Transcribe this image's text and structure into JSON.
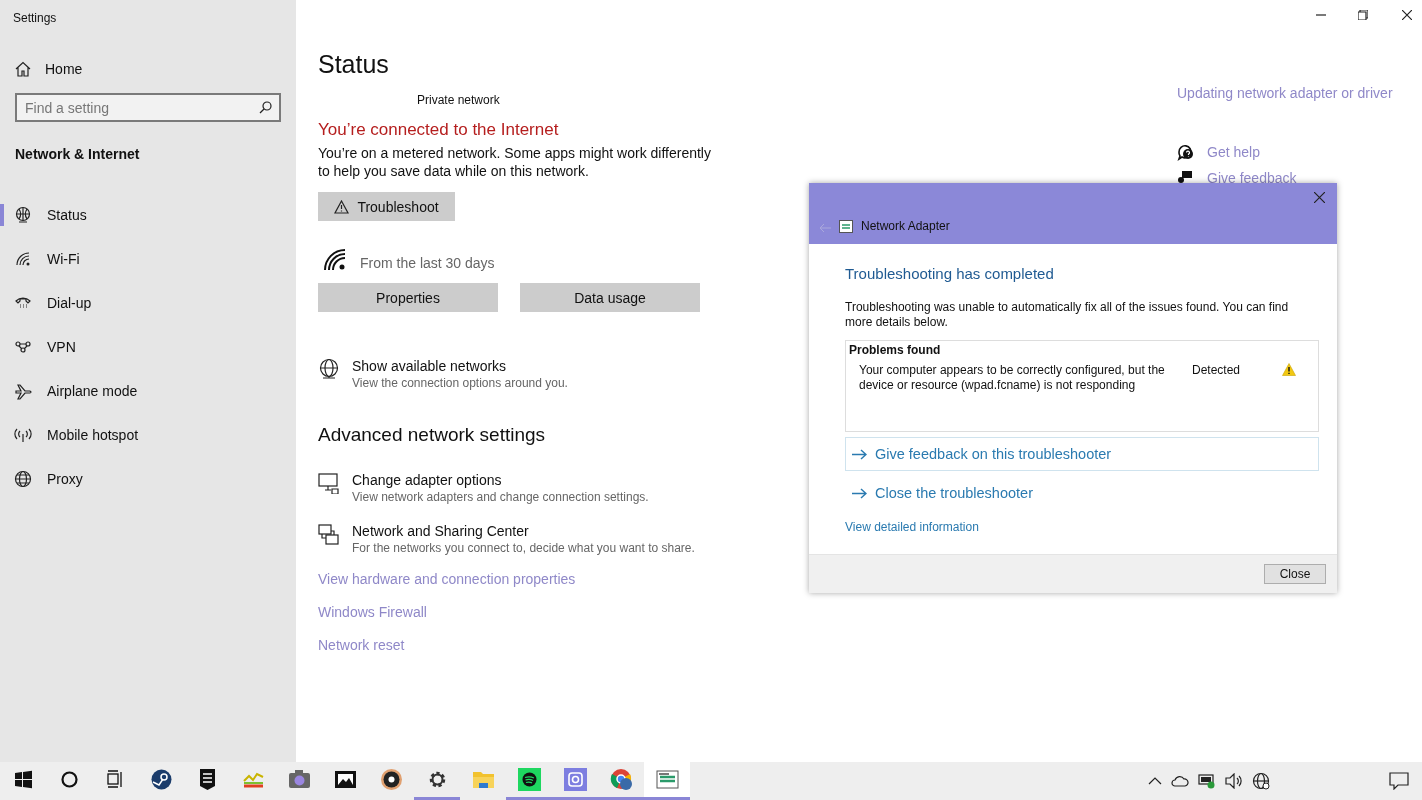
{
  "window": {
    "title": "Settings"
  },
  "sidebar": {
    "home": "Home",
    "search": {
      "placeholder": "Find a setting"
    },
    "section": "Network & Internet",
    "items": [
      {
        "label": "Status",
        "kind": "status",
        "selected": true
      },
      {
        "label": "Wi-Fi",
        "kind": "wifi",
        "selected": false
      },
      {
        "label": "Dial-up",
        "kind": "dialup",
        "selected": false
      },
      {
        "label": "VPN",
        "kind": "vpn",
        "selected": false
      },
      {
        "label": "Airplane mode",
        "kind": "airplane",
        "selected": false
      },
      {
        "label": "Mobile hotspot",
        "kind": "hotspot",
        "selected": false
      },
      {
        "label": "Proxy",
        "kind": "proxy",
        "selected": false
      }
    ]
  },
  "main": {
    "title": "Status",
    "network_name": "Private network",
    "connection_heading": "You’re connected to the Internet",
    "connection_text": "You’re on a metered network. Some apps might work differently to help you save data while on this network.",
    "troubleshoot_button": "Troubleshoot",
    "usage_caption": "From the last 30 days",
    "buttons": [
      "Properties",
      "Data usage"
    ],
    "show_networks": {
      "kind": "networks",
      "title": "Show available networks",
      "subtitle": "View the connection options around you."
    },
    "advanced_heading": "Advanced network settings",
    "advanced_items": [
      {
        "kind": "adapter",
        "title": "Change adapter options",
        "subtitle": "View network adapters and change connection settings."
      },
      {
        "kind": "sharing",
        "title": "Network and Sharing Center",
        "subtitle": "For the networks you connect to, decide what you want to share."
      }
    ],
    "links": [
      "View hardware and connection properties",
      "Windows Firewall",
      "Network reset"
    ]
  },
  "related": {
    "links": [
      "Updating network adapter or driver"
    ],
    "help": [
      {
        "kind": "help",
        "label": "Get help"
      },
      {
        "kind": "feedback",
        "label": "Give feedback"
      }
    ]
  },
  "dialog": {
    "title": "Network Adapter",
    "heading": "Troubleshooting has completed",
    "message": "Troubleshooting was unable to automatically fix all of the issues found. You can find more details below.",
    "problems": {
      "heading": "Problems found",
      "rows": [
        {
          "text": "Your computer appears to be correctly configured, but the device or resource (wpad.fcname) is not responding",
          "status": "Detected",
          "kind": "warning"
        }
      ]
    },
    "actions": [
      {
        "label": "Give feedback on this troubleshooter",
        "focused": true
      },
      {
        "label": "Close the troubleshooter",
        "focused": false
      }
    ],
    "details_link": "View detailed information",
    "close_button": "Close"
  },
  "taskbar": {
    "apps": [
      {
        "kind": "start",
        "running": false,
        "selected": false
      },
      {
        "kind": "search",
        "running": false,
        "selected": false
      },
      {
        "kind": "taskview",
        "running": false,
        "selected": false
      },
      {
        "kind": "steam",
        "running": false,
        "selected": false
      },
      {
        "kind": "epic",
        "running": false,
        "selected": false
      },
      {
        "kind": "chart",
        "running": false,
        "selected": false
      },
      {
        "kind": "camera",
        "running": false,
        "selected": false
      },
      {
        "kind": "photos",
        "running": false,
        "selected": false
      },
      {
        "kind": "music",
        "running": false,
        "selected": false
      },
      {
        "kind": "settings",
        "running": true,
        "selected": false
      },
      {
        "kind": "folder",
        "running": false,
        "selected": false
      },
      {
        "kind": "spotify",
        "running": true,
        "selected": false
      },
      {
        "kind": "insta",
        "running": true,
        "selected": false
      },
      {
        "kind": "chrome",
        "running": true,
        "selected": false
      },
      {
        "kind": "troubleshooter",
        "running": true,
        "selected": true
      }
    ]
  }
}
